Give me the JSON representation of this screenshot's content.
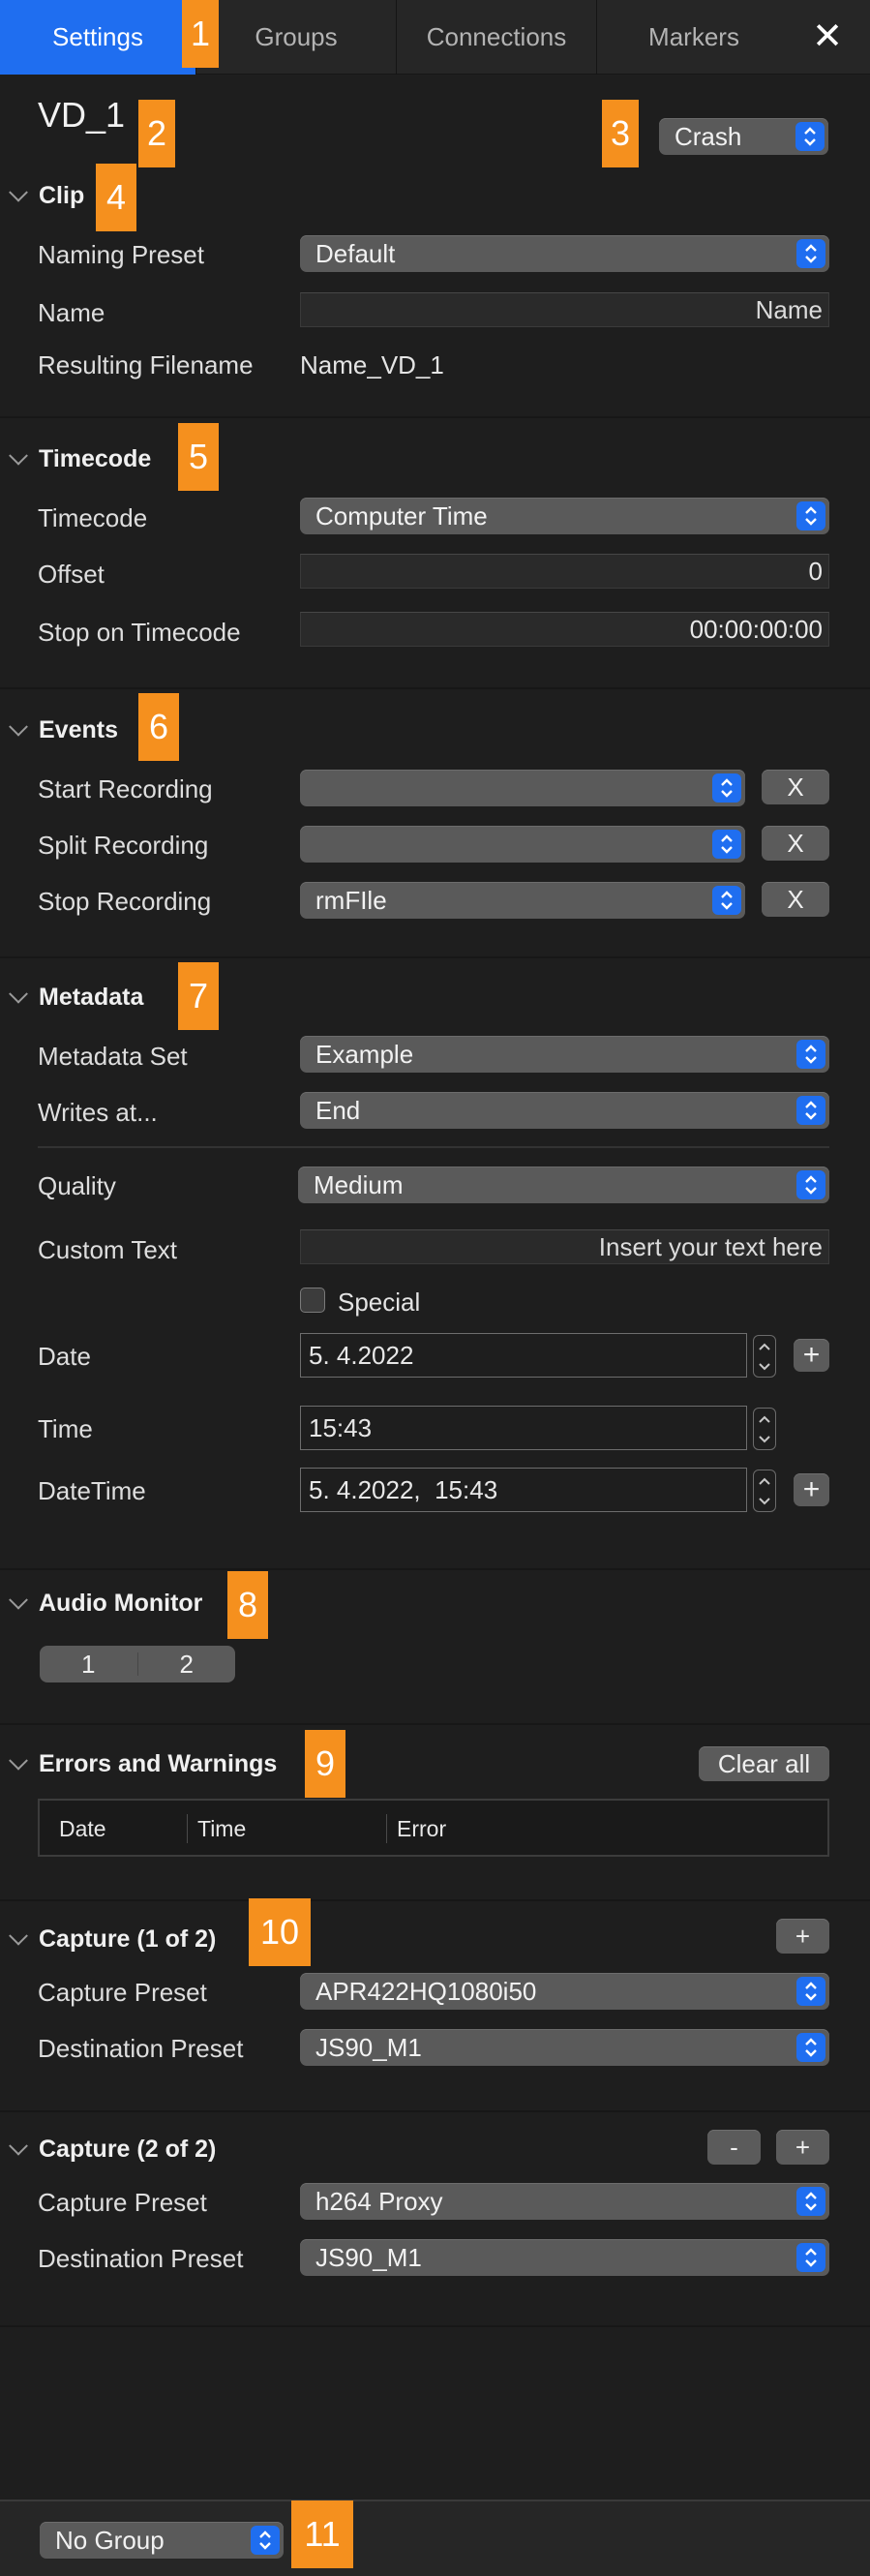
{
  "tabs": [
    "Settings",
    "Groups",
    "Connections",
    "Markers"
  ],
  "close_symbol": "✕",
  "accent_color": "#1f6ef0",
  "badge_color": "#f5901e",
  "badges": [
    "1",
    "2",
    "3",
    "4",
    "5",
    "6",
    "7",
    "8",
    "9",
    "10",
    "11"
  ],
  "device": {
    "name": "VD_1",
    "crash_select": "Crash"
  },
  "clip": {
    "title": "Clip",
    "naming_preset_label": "Naming Preset",
    "naming_preset_value": "Default",
    "name_label": "Name",
    "name_placeholder": "Name",
    "resulting_label": "Resulting Filename",
    "resulting_value": "Name_VD_1"
  },
  "timecode": {
    "title": "Timecode",
    "timecode_label": "Timecode",
    "timecode_value": "Computer Time",
    "offset_label": "Offset",
    "offset_value": "0",
    "stop_label": "Stop on Timecode",
    "stop_value": "00:00:00:00"
  },
  "events": {
    "title": "Events",
    "rows": [
      {
        "label": "Start Recording",
        "value": "",
        "clear": "X"
      },
      {
        "label": "Split Recording",
        "value": "",
        "clear": "X"
      },
      {
        "label": "Stop Recording",
        "value": "rmFIle",
        "clear": "X"
      }
    ]
  },
  "metadata": {
    "title": "Metadata",
    "set_label": "Metadata Set",
    "set_value": "Example",
    "writes_label": "Writes at...",
    "writes_value": "End",
    "quality_label": "Quality",
    "quality_value": "Medium",
    "custom_label": "Custom Text",
    "custom_placeholder": "Insert your text here",
    "special_label": "Special",
    "special_checked": false,
    "date_label": "Date",
    "date_value": "5. 4.2022",
    "time_label": "Time",
    "time_value": "15:43",
    "datetime_label": "DateTime",
    "datetime_value": "5. 4.2022,  15:43",
    "plus": "+"
  },
  "audio_monitor": {
    "title": "Audio Monitor",
    "channels": [
      "1",
      "2"
    ]
  },
  "errors": {
    "title": "Errors and Warnings",
    "clear_all": "Clear all",
    "columns": [
      "Date",
      "Time",
      "Error"
    ]
  },
  "capture1": {
    "title": "Capture (1 of 2)",
    "add": "+",
    "capture_label": "Capture Preset",
    "capture_value": "APR422HQ1080i50",
    "dest_label": "Destination Preset",
    "dest_value": "JS90_M1"
  },
  "capture2": {
    "title": "Capture (2 of 2)",
    "remove": "-",
    "add": "+",
    "capture_label": "Capture Preset",
    "capture_value": "h264 Proxy",
    "dest_label": "Destination Preset",
    "dest_value": "JS90_M1"
  },
  "footer": {
    "group_select": "No Group"
  }
}
